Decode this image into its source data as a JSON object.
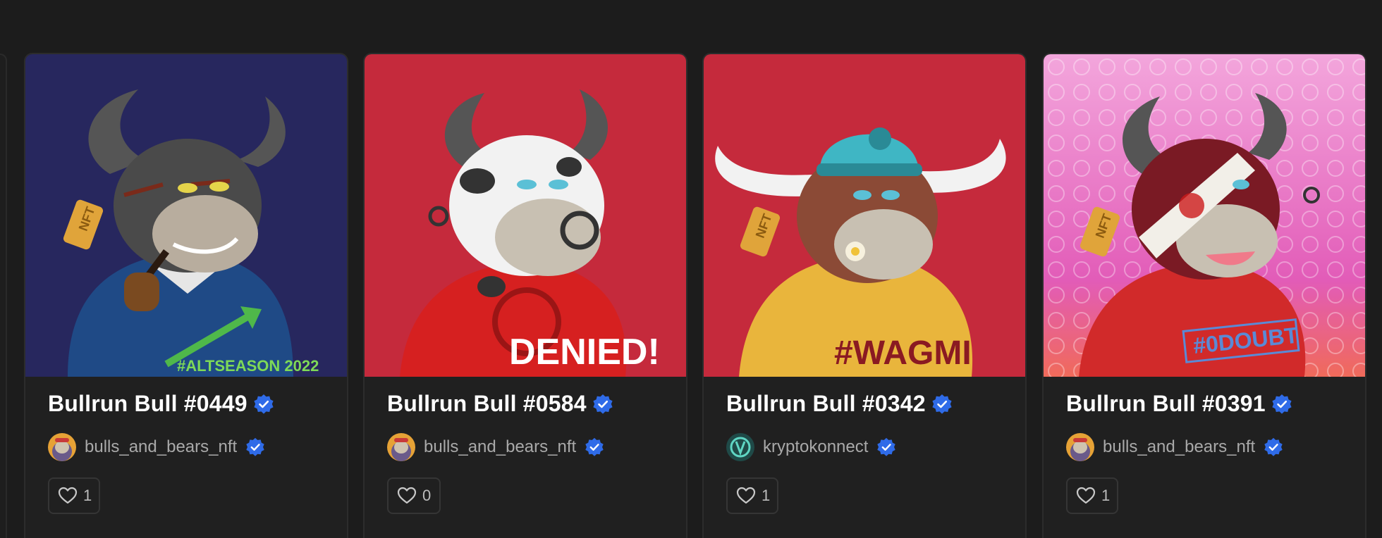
{
  "cards": [
    {
      "title": "Bullrun Bull #0449",
      "creator": "bulls_and_bears_nft",
      "likes": "1",
      "art": {
        "background": "#27275e",
        "shirt": "#1f4a86",
        "shirt_text": "#ALTSEASON 2022",
        "shirt_text_color": "#7ed957",
        "fur": "#4a4a4a",
        "accessory": "pipe",
        "tag_text": "NFT"
      }
    },
    {
      "title": "Bullrun Bull #0584",
      "creator": "bulls_and_bears_nft",
      "likes": "0",
      "art": {
        "background": "#c52a3c",
        "shirt": "#d62020",
        "shirt_text": "DENIED!",
        "shirt_text_color": "#ffffff",
        "fur": "#f2f2f2",
        "accessory": "nose-ring"
      }
    },
    {
      "title": "Bullrun Bull #0342",
      "creator": "kryptokonnect",
      "likes": "1",
      "art": {
        "background": "#c52a3c",
        "shirt": "#e9b53c",
        "shirt_text": "#WAGMI",
        "shirt_text_color": "#8a1a22",
        "fur": "#8b4a36",
        "accessory": "cap-and-flower",
        "tag_text": "NFT"
      }
    },
    {
      "title": "Bullrun Bull #0391",
      "creator": "bulls_and_bears_nft",
      "likes": "1",
      "art": {
        "background": "#e878c8",
        "shirt": "#d12a2a",
        "shirt_text": "#0DOUBT",
        "shirt_text_color": "#5a8ad6",
        "fur": "#7a1a24",
        "accessory": "bandage",
        "tag_text": "NFT"
      }
    }
  ],
  "colors": {
    "page_bg": "#1c1c1c",
    "card_bg": "#202020",
    "verified_blue": "#2f6be8",
    "title_text": "#ffffff",
    "muted_text": "#a9a9a9"
  }
}
